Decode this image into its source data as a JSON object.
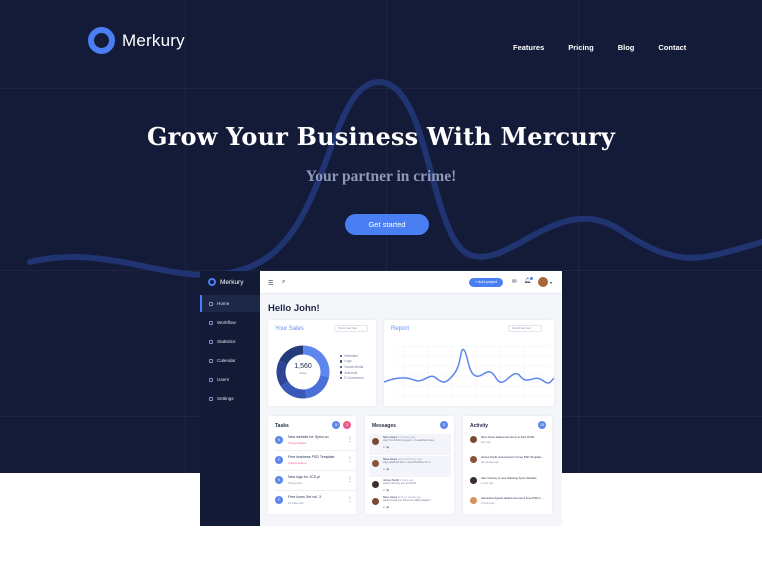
{
  "colors": {
    "hero_bg": "#131b38",
    "accent": "#4a7ff3",
    "subtitle": "#8f98b8",
    "sidebar_bg": "#121a36",
    "badge_pink": "#ef5a8c"
  },
  "brand": {
    "name": "Merkury",
    "logo_icon": "ring-logo-icon"
  },
  "nav": {
    "items": [
      "Features",
      "Pricing",
      "Blog",
      "Contact"
    ]
  },
  "hero": {
    "headline": "Grow Your Business With Mercury",
    "subheadline": "Your partner in crime!",
    "cta_label": "Get started"
  },
  "dashboard": {
    "brand": "Merkury",
    "sidebar": [
      {
        "label": "Home",
        "icon": "home-icon",
        "active": true
      },
      {
        "label": "Workflow",
        "icon": "grid-icon"
      },
      {
        "label": "Statistics",
        "icon": "chart-icon"
      },
      {
        "label": "Calendar",
        "icon": "calendar-icon"
      },
      {
        "label": "Users",
        "icon": "users-icon"
      },
      {
        "label": "Settings",
        "icon": "gear-icon"
      }
    ],
    "topbar": {
      "add_label": "+ Add project",
      "menu_icon": "menu-icon",
      "search_icon": "search-icon",
      "mail_icon": "mail-icon",
      "bell_icon": "bell-icon"
    },
    "greeting": "Hello John!",
    "sales": {
      "title": "Your Sales",
      "range": "Period: last Year",
      "total": "1,560",
      "total_label": "Sales",
      "legend": [
        "Websites",
        "Logo",
        "Social Media",
        "Adwords",
        "E-Commerce"
      ]
    },
    "report": {
      "title": "Report",
      "range": "Period: last Year"
    },
    "tasks": {
      "title": "Tasks",
      "badge_blue": "5",
      "badge_pink": "2",
      "items": [
        {
          "title": "New website for Symu.co",
          "meta": "5 days delays",
          "initial": "N"
        },
        {
          "title": "Free business PSD Template",
          "meta": "5 days delays",
          "initial": "F"
        },
        {
          "title": "New logo for JCD.pl",
          "meta": "5 days left",
          "initial": "N"
        },
        {
          "title": "Free Icons Set vol. 3",
          "meta": "10 days left",
          "initial": "F"
        }
      ]
    },
    "messages": {
      "title": "Messages",
      "badge": "2",
      "items": [
        {
          "name": "Nina Jones",
          "time": "5 minutes ago",
          "text": "Hey! You'll find the agent - it's attached here..."
        },
        {
          "name": "Nina Jones",
          "time": "about 20 hours ago",
          "text": "Hey! attached here a new PSD files for 1..."
        },
        {
          "name": "James Smith",
          "time": "2 days ago",
          "text": "Good morning, you are fired!"
        },
        {
          "name": "Nina Jones",
          "time": "about 2 weeks ago",
          "text": "Hello! Could you bring me coffee please?"
        }
      ]
    },
    "activity": {
      "title": "Activity",
      "badge": "10",
      "items": [
        {
          "text": "Nina Jones added new items to Fast HTML",
          "time": "just now"
        },
        {
          "text": "James Smith commented on Free PSD Template",
          "time": "40 minutes ago"
        },
        {
          "text": "Alex Clooney is now following Symu Website",
          "time": "1 hour ago"
        },
        {
          "text": "Alexandra Spears added new items Free PSD L...",
          "time": "3 hours ago"
        }
      ]
    }
  },
  "chart_data": {
    "type": "pie",
    "categories": [
      "Websites",
      "Logo",
      "Social Media",
      "Adwords",
      "E-Commerce"
    ],
    "values": [
      28,
      20,
      18,
      16,
      18
    ],
    "title": "Your Sales"
  }
}
